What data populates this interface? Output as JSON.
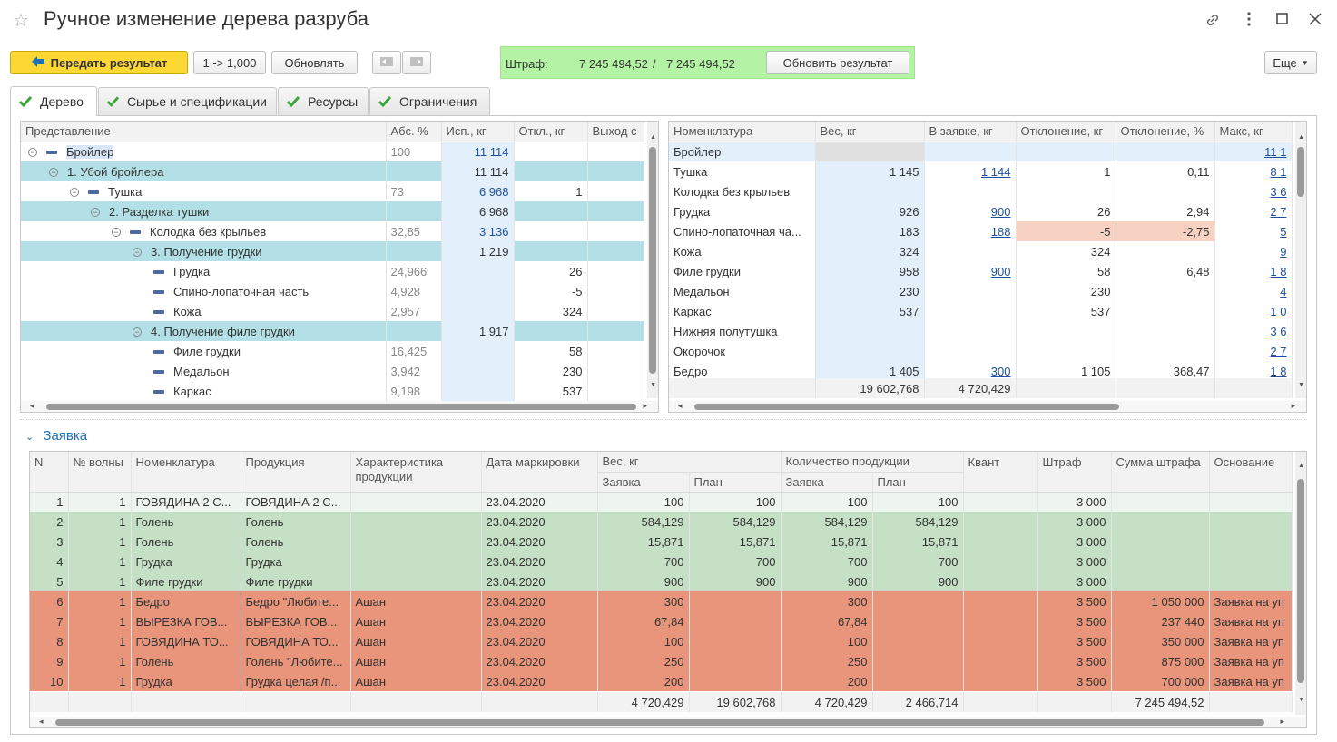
{
  "window": {
    "title": "Ручное изменение дерева разруба",
    "star_icon": "star-icon",
    "link_icon": "link-icon",
    "more_icon": "more-vertical-icon",
    "maximize_icon": "maximize-icon",
    "close_icon": "close-icon"
  },
  "toolbar": {
    "send_result": "Передать результат",
    "ratio": "1 -> 1,000",
    "refresh": "Обновлять",
    "fine_label": "Штраф:",
    "fine_value1": "7 245 494,52",
    "fine_sep": "/",
    "fine_value2": "7 245 494,52",
    "update_result": "Обновить результат",
    "more": "Еще"
  },
  "tabs": [
    {
      "label": "Дерево",
      "active": true
    },
    {
      "label": "Сырье и спецификации",
      "active": false
    },
    {
      "label": "Ресурсы",
      "active": false
    },
    {
      "label": "Ограничения",
      "active": false
    }
  ],
  "tree": {
    "headers": [
      "Представление",
      "Абс. %",
      "Исп., кг",
      "Откл., кг",
      "Выход с"
    ],
    "rows": [
      {
        "level": 0,
        "kind": "node",
        "name": "Бройлер",
        "abs": "100",
        "used": "11 114",
        "dev": "",
        "sel": true
      },
      {
        "level": 1,
        "kind": "op",
        "name": "1. Убой бройлера",
        "abs": "",
        "used": "11 114",
        "dev": ""
      },
      {
        "level": 2,
        "kind": "node",
        "name": "Тушка",
        "abs": "73",
        "used": "6 968",
        "dev": "1"
      },
      {
        "level": 3,
        "kind": "op",
        "name": "2. Разделка тушки",
        "abs": "",
        "used": "6 968",
        "dev": ""
      },
      {
        "level": 4,
        "kind": "node",
        "name": "Колодка без крыльев",
        "abs": "32,85",
        "used": "3 136",
        "dev": ""
      },
      {
        "level": 5,
        "kind": "op",
        "name": "3. Получение грудки",
        "abs": "",
        "used": "1 219",
        "dev": ""
      },
      {
        "level": 6,
        "kind": "leaf",
        "name": "Грудка",
        "abs": "24,966",
        "used": "",
        "dev": "26"
      },
      {
        "level": 6,
        "kind": "leaf",
        "name": "Спино-лопаточная часть",
        "abs": "4,928",
        "used": "",
        "dev": "-5"
      },
      {
        "level": 6,
        "kind": "leaf",
        "name": "Кожа",
        "abs": "2,957",
        "used": "",
        "dev": "324"
      },
      {
        "level": 5,
        "kind": "op",
        "name": "4. Получение филе грудки",
        "abs": "",
        "used": "1 917",
        "dev": ""
      },
      {
        "level": 6,
        "kind": "leaf",
        "name": "Филе грудки",
        "abs": "16,425",
        "used": "",
        "dev": "58"
      },
      {
        "level": 6,
        "kind": "leaf",
        "name": "Медальон",
        "abs": "3,942",
        "used": "",
        "dev": "230"
      },
      {
        "level": 6,
        "kind": "leaf",
        "name": "Каркас",
        "abs": "9,198",
        "used": "",
        "dev": "537"
      }
    ]
  },
  "nomen": {
    "headers": [
      "Номенклатура",
      "Вес, кг",
      "В заявке, кг",
      "Отклонение, кг",
      "Отклонение, %",
      "Макс, кг"
    ],
    "rows": [
      {
        "name": "Бройлер",
        "weight": "",
        "order": "",
        "dev": "",
        "devp": "",
        "max": "11 1"
      },
      {
        "name": "Тушка",
        "weight": "1 145",
        "order": "1 144",
        "dev": "1",
        "devp": "0,11",
        "max": "8 1"
      },
      {
        "name": "Колодка без крыльев",
        "weight": "",
        "order": "",
        "dev": "",
        "devp": "",
        "max": "3 6"
      },
      {
        "name": "Грудка",
        "weight": "926",
        "order": "900",
        "dev": "26",
        "devp": "2,94",
        "max": "2 7"
      },
      {
        "name": "Спино-лопаточная ча...",
        "weight": "183",
        "order": "188",
        "dev": "-5",
        "devp": "-2,75",
        "max": "5",
        "neg": true
      },
      {
        "name": "Кожа",
        "weight": "324",
        "order": "",
        "dev": "324",
        "devp": "",
        "max": "9"
      },
      {
        "name": "Филе грудки",
        "weight": "958",
        "order": "900",
        "dev": "58",
        "devp": "6,48",
        "max": "1 8"
      },
      {
        "name": "Медальон",
        "weight": "230",
        "order": "",
        "dev": "230",
        "devp": "",
        "max": "4"
      },
      {
        "name": "Каркас",
        "weight": "537",
        "order": "",
        "dev": "537",
        "devp": "",
        "max": "1 0"
      },
      {
        "name": "Нижняя полутушка",
        "weight": "",
        "order": "",
        "dev": "",
        "devp": "",
        "max": "3 6"
      },
      {
        "name": "Окорочок",
        "weight": "",
        "order": "",
        "dev": "",
        "devp": "",
        "max": "2 7"
      },
      {
        "name": "Бедро",
        "weight": "1 405",
        "order": "300",
        "dev": "1 105",
        "devp": "368,47",
        "max": "1 8"
      }
    ],
    "footer": {
      "weight": "19 602,768",
      "order": "4 720,429"
    }
  },
  "order": {
    "section_title": "Заявка",
    "headers": {
      "n": "N",
      "wave": "№ волны",
      "nomen": "Номенклатура",
      "product": "Продукция",
      "char": "Характеристика продукции",
      "date": "Дата маркировки",
      "weight": "Вес, кг",
      "qty": "Количество продукции",
      "req": "Заявка",
      "plan": "План",
      "quant": "Квант",
      "fine": "Штраф",
      "fine_sum": "Сумма штрафа",
      "reason": "Основание"
    },
    "rows": [
      {
        "n": "1",
        "wave": "1",
        "nomen": "ГОВЯДИНА 2 С...",
        "product": "ГОВЯДИНА 2 С...",
        "char": "",
        "date": "23.04.2020",
        "w_req": "100",
        "w_plan": "100",
        "q_req": "100",
        "q_plan": "100",
        "quant": "",
        "fine": "3 000",
        "fine_sum": "",
        "reason": "",
        "color": "light"
      },
      {
        "n": "2",
        "wave": "1",
        "nomen": "Голень",
        "product": "Голень",
        "char": "",
        "date": "23.04.2020",
        "w_req": "584,129",
        "w_plan": "584,129",
        "q_req": "584,129",
        "q_plan": "584,129",
        "quant": "",
        "fine": "3 000",
        "fine_sum": "",
        "reason": "",
        "color": "green"
      },
      {
        "n": "3",
        "wave": "1",
        "nomen": "Голень",
        "product": "Голень",
        "char": "",
        "date": "23.04.2020",
        "w_req": "15,871",
        "w_plan": "15,871",
        "q_req": "15,871",
        "q_plan": "15,871",
        "quant": "",
        "fine": "3 000",
        "fine_sum": "",
        "reason": "",
        "color": "green"
      },
      {
        "n": "4",
        "wave": "1",
        "nomen": "Грудка",
        "product": "Грудка",
        "char": "",
        "date": "23.04.2020",
        "w_req": "700",
        "w_plan": "700",
        "q_req": "700",
        "q_plan": "700",
        "quant": "",
        "fine": "3 000",
        "fine_sum": "",
        "reason": "",
        "color": "green"
      },
      {
        "n": "5",
        "wave": "1",
        "nomen": "Филе грудки",
        "product": "Филе грудки",
        "char": "",
        "date": "23.04.2020",
        "w_req": "900",
        "w_plan": "900",
        "q_req": "900",
        "q_plan": "900",
        "quant": "",
        "fine": "3 000",
        "fine_sum": "",
        "reason": "",
        "color": "green"
      },
      {
        "n": "6",
        "wave": "1",
        "nomen": "Бедро",
        "product": "Бедро \"Любите...",
        "char": "Ашан",
        "date": "23.04.2020",
        "w_req": "300",
        "w_plan": "",
        "q_req": "300",
        "q_plan": "",
        "quant": "",
        "fine": "3 500",
        "fine_sum": "1 050 000",
        "reason": "Заявка на уп",
        "color": "red"
      },
      {
        "n": "7",
        "wave": "1",
        "nomen": "ВЫРЕЗКА ГОВ...",
        "product": "ВЫРЕЗКА ГОВ...",
        "char": "Ашан",
        "date": "23.04.2020",
        "w_req": "67,84",
        "w_plan": "",
        "q_req": "67,84",
        "q_plan": "",
        "quant": "",
        "fine": "3 500",
        "fine_sum": "237 440",
        "reason": "Заявка на уп",
        "color": "red"
      },
      {
        "n": "8",
        "wave": "1",
        "nomen": "ГОВЯДИНА ТО...",
        "product": "ГОВЯДИНА ТО...",
        "char": "Ашан",
        "date": "23.04.2020",
        "w_req": "100",
        "w_plan": "",
        "q_req": "100",
        "q_plan": "",
        "quant": "",
        "fine": "3 500",
        "fine_sum": "350 000",
        "reason": "Заявка на уп",
        "color": "red"
      },
      {
        "n": "9",
        "wave": "1",
        "nomen": "Голень",
        "product": "Голень \"Любите...",
        "char": "Ашан",
        "date": "23.04.2020",
        "w_req": "250",
        "w_plan": "",
        "q_req": "250",
        "q_plan": "",
        "quant": "",
        "fine": "3 500",
        "fine_sum": "875 000",
        "reason": "Заявка на уп",
        "color": "red"
      },
      {
        "n": "10",
        "wave": "1",
        "nomen": "Грудка",
        "product": "Грудка целая /п...",
        "char": "Ашан",
        "date": "23.04.2020",
        "w_req": "200",
        "w_plan": "",
        "q_req": "200",
        "q_plan": "",
        "quant": "",
        "fine": "3 500",
        "fine_sum": "700 000",
        "reason": "Заявка на уп",
        "color": "red"
      }
    ],
    "footer": {
      "w_req": "4 720,429",
      "w_plan": "19 602,768",
      "q_req": "4 720,429",
      "q_plan": "2 466,714",
      "fine_sum": "7 245 494,52"
    }
  },
  "colors": {
    "accent_yellow": "#fdd835",
    "fine_green": "#b3f3a3",
    "op_row": "#b3e0e6",
    "ok_row": "#c5e0c5",
    "bad_row": "#e8957b",
    "link": "#1c4f9c"
  }
}
